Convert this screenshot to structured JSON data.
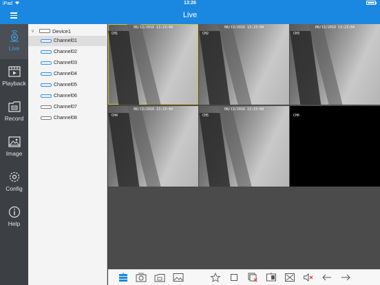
{
  "status_bar": {
    "device": "iPad",
    "time": "13:26"
  },
  "navbar": {
    "title": "Live"
  },
  "sidebar": {
    "tabs": [
      {
        "label": "Live",
        "icon": "live-icon",
        "active": true
      },
      {
        "label": "Playback",
        "icon": "playback-icon"
      },
      {
        "label": "Record",
        "icon": "record-icon"
      },
      {
        "label": "Image",
        "icon": "image-icon"
      },
      {
        "label": "Config",
        "icon": "config-icon"
      },
      {
        "label": "Help",
        "icon": "help-icon"
      }
    ]
  },
  "tree": {
    "device": "Device1",
    "channels": [
      "Channel01",
      "Channel02",
      "Channel03",
      "Channel04",
      "Channel05",
      "Channel06",
      "Channel07",
      "Channel08"
    ]
  },
  "grid": {
    "timestamp": "08/13/2016 13:23:04",
    "cells": [
      {
        "label": "CH1",
        "state": "live",
        "selected": true
      },
      {
        "label": "CH2",
        "state": "live"
      },
      {
        "label": "CH3",
        "state": "live"
      },
      {
        "label": "CH4",
        "state": "live"
      },
      {
        "label": "CH5",
        "state": "live"
      },
      {
        "label": "CH6",
        "state": "black"
      },
      {
        "label": "",
        "state": "empty"
      },
      {
        "label": "",
        "state": "empty"
      },
      {
        "label": "",
        "state": "empty"
      }
    ]
  },
  "toolbar": {
    "icons": [
      "layout-icon",
      "snapshot-icon",
      "record-clip-icon",
      "image-icon",
      "favorite-icon",
      "stop-icon",
      "close-all-icon",
      "split-screen-icon",
      "fullscreen-icon",
      "mute-icon",
      "previous-page-icon",
      "next-page-icon"
    ]
  },
  "colors": {
    "accent": "#1a87e0",
    "selected_border": "#d4c43c",
    "sidebar_bg": "#3c3f44"
  }
}
